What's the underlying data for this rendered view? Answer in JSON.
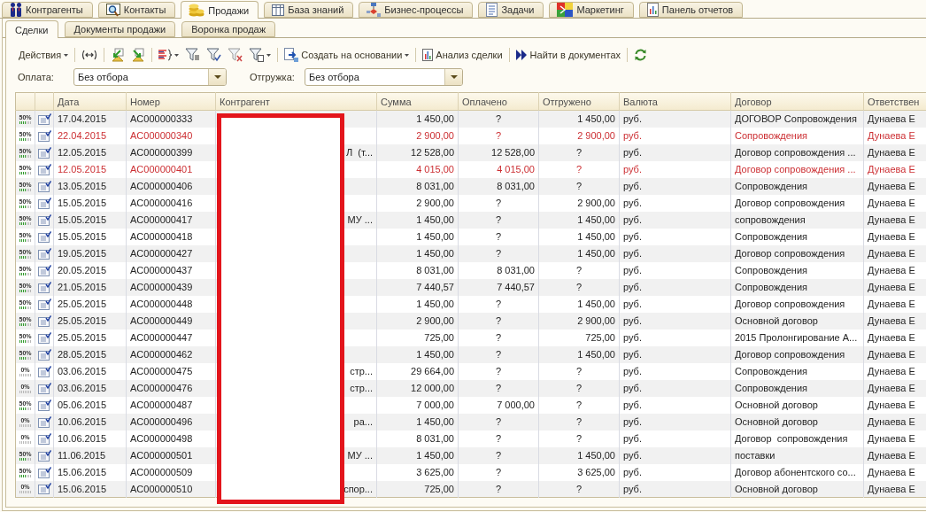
{
  "main_tabs": [
    {
      "label": "Контрагенты",
      "selected": false
    },
    {
      "label": "Контакты",
      "selected": false
    },
    {
      "label": "Продажи",
      "selected": true
    },
    {
      "label": "База знаний",
      "selected": false
    },
    {
      "label": "Бизнес-процессы",
      "selected": false
    },
    {
      "label": "Задачи",
      "selected": false
    },
    {
      "label": "Маркетинг",
      "selected": false
    },
    {
      "label": "Панель отчетов",
      "selected": false
    }
  ],
  "sub_tabs": [
    {
      "label": "Сделки",
      "selected": true
    },
    {
      "label": "Документы продажи",
      "selected": false
    },
    {
      "label": "Воронка продаж",
      "selected": false
    }
  ],
  "toolbar": {
    "actions": "Действия",
    "create_based_on": "Создать на основании",
    "deal_analysis": "Анализ сделки",
    "find_in_documents": "Найти в документах"
  },
  "filters": [
    {
      "label": "Оплата:",
      "value": "Без отбора"
    },
    {
      "label": "Отгружка:",
      "value": "Без отбора"
    }
  ],
  "table": {
    "columns": [
      "Дата",
      "Номер",
      "Контрагент",
      "Сумма",
      "Оплачено",
      "Отгружено",
      "Валюта",
      "Договор",
      "Ответствен"
    ],
    "rows": [
      {
        "progress": "50%",
        "level": 0.5,
        "highlighted": false,
        "date": "17.04.2015",
        "number": "AC000000333",
        "amount": "1 450,00",
        "paid": {
          "kind": "unset",
          "text": "?"
        },
        "shipped": {
          "kind": "amount",
          "text": "1 450,00"
        },
        "currency": "руб.",
        "contract": "ДОГОВОР Сопровождения",
        "responsible": "Дунаева Е"
      },
      {
        "progress": "50%",
        "level": 0.5,
        "highlighted": true,
        "date": "22.04.2015",
        "number": "AC000000340",
        "amount": "2 900,00",
        "paid": {
          "kind": "unset",
          "text": "?"
        },
        "shipped": {
          "kind": "amount",
          "text": "2 900,00"
        },
        "currency": "руб.",
        "contract": "Сопровождения",
        "responsible": "Дунаева Е"
      },
      {
        "progress": "50%",
        "level": 0.5,
        "highlighted": false,
        "date": "12.05.2015",
        "number": "AC000000399",
        "counterparty": "Л  (т...",
        "amount": "12 528,00",
        "paid": {
          "kind": "amount",
          "text": "12 528,00"
        },
        "shipped": {
          "kind": "unset",
          "text": "?"
        },
        "currency": "руб.",
        "contract": "Договор сопровождения ...",
        "responsible": "Дунаева Е"
      },
      {
        "progress": "50%",
        "level": 0.5,
        "highlighted": true,
        "date": "12.05.2015",
        "number": "AC000000401",
        "amount": "4 015,00",
        "paid": {
          "kind": "amount",
          "text": "4 015,00"
        },
        "shipped": {
          "kind": "unset",
          "text": "?"
        },
        "currency": "руб.",
        "contract": "Договор сопровождения ...",
        "responsible": "Дунаева Е"
      },
      {
        "progress": "50%",
        "level": 0.5,
        "highlighted": false,
        "date": "13.05.2015",
        "number": "AC000000406",
        "amount": "8 031,00",
        "paid": {
          "kind": "amount",
          "text": "8 031,00"
        },
        "shipped": {
          "kind": "unset",
          "text": "?"
        },
        "currency": "руб.",
        "contract": "Сопровождения",
        "responsible": "Дунаева Е"
      },
      {
        "progress": "50%",
        "level": 0.5,
        "highlighted": false,
        "date": "15.05.2015",
        "number": "AC000000416",
        "amount": "2 900,00",
        "paid": {
          "kind": "unset",
          "text": "?"
        },
        "shipped": {
          "kind": "amount",
          "text": "2 900,00"
        },
        "currency": "руб.",
        "contract": "Договор сопровождения",
        "responsible": "Дунаева Е"
      },
      {
        "progress": "50%",
        "level": 0.5,
        "highlighted": false,
        "date": "15.05.2015",
        "number": "AC000000417",
        "counterparty": "МУ ...",
        "amount": "1 450,00",
        "paid": {
          "kind": "unset",
          "text": "?"
        },
        "shipped": {
          "kind": "amount",
          "text": "1 450,00"
        },
        "currency": "руб.",
        "contract": "сопровождения",
        "responsible": "Дунаева Е"
      },
      {
        "progress": "50%",
        "level": 0.5,
        "highlighted": false,
        "date": "15.05.2015",
        "number": "AC000000418",
        "amount": "1 450,00",
        "paid": {
          "kind": "unset",
          "text": "?"
        },
        "shipped": {
          "kind": "amount",
          "text": "1 450,00"
        },
        "currency": "руб.",
        "contract": "Сопровождения",
        "responsible": "Дунаева Е"
      },
      {
        "progress": "50%",
        "level": 0.5,
        "highlighted": false,
        "date": "19.05.2015",
        "number": "AC000000427",
        "amount": "1 450,00",
        "paid": {
          "kind": "unset",
          "text": "?"
        },
        "shipped": {
          "kind": "amount",
          "text": "1 450,00"
        },
        "currency": "руб.",
        "contract": "Договор сопровождения",
        "responsible": "Дунаева Е"
      },
      {
        "progress": "50%",
        "level": 0.5,
        "highlighted": false,
        "date": "20.05.2015",
        "number": "AC000000437",
        "amount": "8 031,00",
        "paid": {
          "kind": "amount",
          "text": "8 031,00"
        },
        "shipped": {
          "kind": "unset",
          "text": "?"
        },
        "currency": "руб.",
        "contract": "Сопровождения",
        "responsible": "Дунаева Е"
      },
      {
        "progress": "50%",
        "level": 0.5,
        "highlighted": false,
        "date": "21.05.2015",
        "number": "AC000000439",
        "amount": "7 440,57",
        "paid": {
          "kind": "amount",
          "text": "7 440,57"
        },
        "shipped": {
          "kind": "unset",
          "text": "?"
        },
        "currency": "руб.",
        "contract": "Сопровождения",
        "responsible": "Дунаева Е"
      },
      {
        "progress": "50%",
        "level": 0.5,
        "highlighted": false,
        "date": "25.05.2015",
        "number": "AC000000448",
        "amount": "1 450,00",
        "paid": {
          "kind": "unset",
          "text": "?"
        },
        "shipped": {
          "kind": "amount",
          "text": "1 450,00"
        },
        "currency": "руб.",
        "contract": "Договор сопровождения",
        "responsible": "Дунаева Е"
      },
      {
        "progress": "50%",
        "level": 0.5,
        "highlighted": false,
        "date": "25.05.2015",
        "number": "AC000000449",
        "amount": "2 900,00",
        "paid": {
          "kind": "unset",
          "text": "?"
        },
        "shipped": {
          "kind": "amount",
          "text": "2 900,00"
        },
        "currency": "руб.",
        "contract": "Основной договор",
        "responsible": "Дунаева Е"
      },
      {
        "progress": "50%",
        "level": 0.5,
        "highlighted": false,
        "date": "25.05.2015",
        "number": "AC000000447",
        "amount": "725,00",
        "paid": {
          "kind": "unset",
          "text": "?"
        },
        "shipped": {
          "kind": "amount",
          "text": "725,00"
        },
        "currency": "руб.",
        "contract": "2015 Пролонгирование А...",
        "responsible": "Дунаева Е"
      },
      {
        "progress": "50%",
        "level": 0.5,
        "highlighted": false,
        "date": "28.05.2015",
        "number": "AC000000462",
        "amount": "1 450,00",
        "paid": {
          "kind": "unset",
          "text": "?"
        },
        "shipped": {
          "kind": "amount",
          "text": "1 450,00"
        },
        "currency": "руб.",
        "contract": "Договор сопровождения",
        "responsible": "Дунаева Е"
      },
      {
        "progress": "0%",
        "level": 0,
        "highlighted": false,
        "date": "03.06.2015",
        "number": "AC000000475",
        "counterparty": "стр...",
        "amount": "29 664,00",
        "paid": {
          "kind": "unset",
          "text": "?"
        },
        "shipped": {
          "kind": "unset",
          "text": "?"
        },
        "currency": "руб.",
        "contract": "Сопровождения",
        "responsible": "Дунаева Е"
      },
      {
        "progress": "0%",
        "level": 0,
        "highlighted": false,
        "date": "03.06.2015",
        "number": "AC000000476",
        "counterparty": "стр...",
        "amount": "12 000,00",
        "paid": {
          "kind": "unset",
          "text": "?"
        },
        "shipped": {
          "kind": "unset",
          "text": "?"
        },
        "currency": "руб.",
        "contract": "Сопровождения",
        "responsible": "Дунаева Е"
      },
      {
        "progress": "50%",
        "level": 0.5,
        "highlighted": false,
        "date": "05.06.2015",
        "number": "AC000000487",
        "amount": "7 000,00",
        "paid": {
          "kind": "amount",
          "text": "7 000,00"
        },
        "shipped": {
          "kind": "unset",
          "text": "?"
        },
        "currency": "руб.",
        "contract": "Основной договор",
        "responsible": "Дунаева Е"
      },
      {
        "progress": "0%",
        "level": 0,
        "highlighted": false,
        "date": "10.06.2015",
        "number": "AC000000496",
        "counterparty": "ра...",
        "amount": "1 450,00",
        "paid": {
          "kind": "unset",
          "text": "?"
        },
        "shipped": {
          "kind": "unset",
          "text": "?"
        },
        "currency": "руб.",
        "contract": "Основной договор",
        "responsible": "Дунаева Е"
      },
      {
        "progress": "0%",
        "level": 0,
        "highlighted": false,
        "date": "10.06.2015",
        "number": "AC000000498",
        "amount": "8 031,00",
        "paid": {
          "kind": "unset",
          "text": "?"
        },
        "shipped": {
          "kind": "unset",
          "text": "?"
        },
        "currency": "руб.",
        "contract": "Договор  сопровождения",
        "responsible": "Дунаева Е"
      },
      {
        "progress": "50%",
        "level": 0.5,
        "highlighted": false,
        "date": "11.06.2015",
        "number": "AC000000501",
        "counterparty": "МУ ...",
        "amount": "1 450,00",
        "paid": {
          "kind": "unset",
          "text": "?"
        },
        "shipped": {
          "kind": "amount",
          "text": "1 450,00"
        },
        "currency": "руб.",
        "contract": "поставки",
        "responsible": "Дунаева Е"
      },
      {
        "progress": "50%",
        "level": 0.5,
        "highlighted": false,
        "date": "15.06.2015",
        "number": "AC000000509",
        "amount": "3 625,00",
        "paid": {
          "kind": "unset",
          "text": "?"
        },
        "shipped": {
          "kind": "amount",
          "text": "3 625,00"
        },
        "currency": "руб.",
        "contract": "Договор абонентского со...",
        "responsible": "Дунаева Е"
      },
      {
        "progress": "0%",
        "level": 0,
        "highlighted": false,
        "date": "15.06.2015",
        "number": "AC000000510",
        "counterparty": "спор...",
        "amount": "725,00",
        "paid": {
          "kind": "unset",
          "text": "?"
        },
        "shipped": {
          "kind": "unset",
          "text": "?"
        },
        "currency": "руб.",
        "contract": "Основной договор",
        "responsible": "Дунаева Е"
      }
    ]
  }
}
